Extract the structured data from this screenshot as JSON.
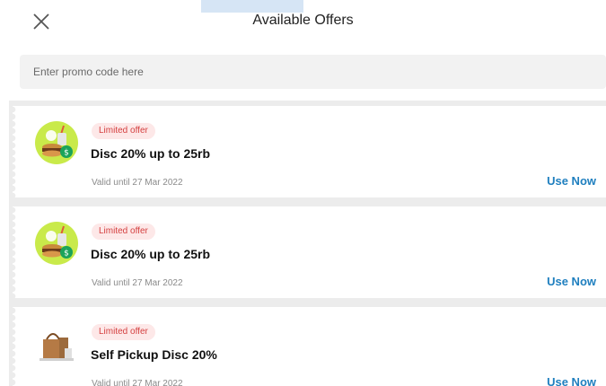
{
  "header": {
    "title": "Available Offers",
    "close_icon": "close-icon"
  },
  "promo": {
    "placeholder": "Enter promo code here",
    "value": ""
  },
  "offers": [
    {
      "badge": "Limited offer",
      "title": "Disc 20% up to 25rb",
      "validity": "Valid until 27 Mar 2022",
      "action": "Use Now",
      "icon": "food-voucher-icon"
    },
    {
      "badge": "Limited offer",
      "title": "Disc 20% up to 25rb",
      "validity": "Valid until 27 Mar 2022",
      "action": "Use Now",
      "icon": "food-voucher-icon"
    },
    {
      "badge": "Limited offer",
      "title": "Self Pickup Disc 20%",
      "validity": "Valid until 27 Mar 2022",
      "action": "Use Now",
      "icon": "pickup-bag-icon"
    }
  ],
  "colors": {
    "accent": "#1f7fbf",
    "badge_text": "#d43f3f",
    "badge_bg": "#fde8e8",
    "food_icon_bg": "#c9ea4a"
  }
}
